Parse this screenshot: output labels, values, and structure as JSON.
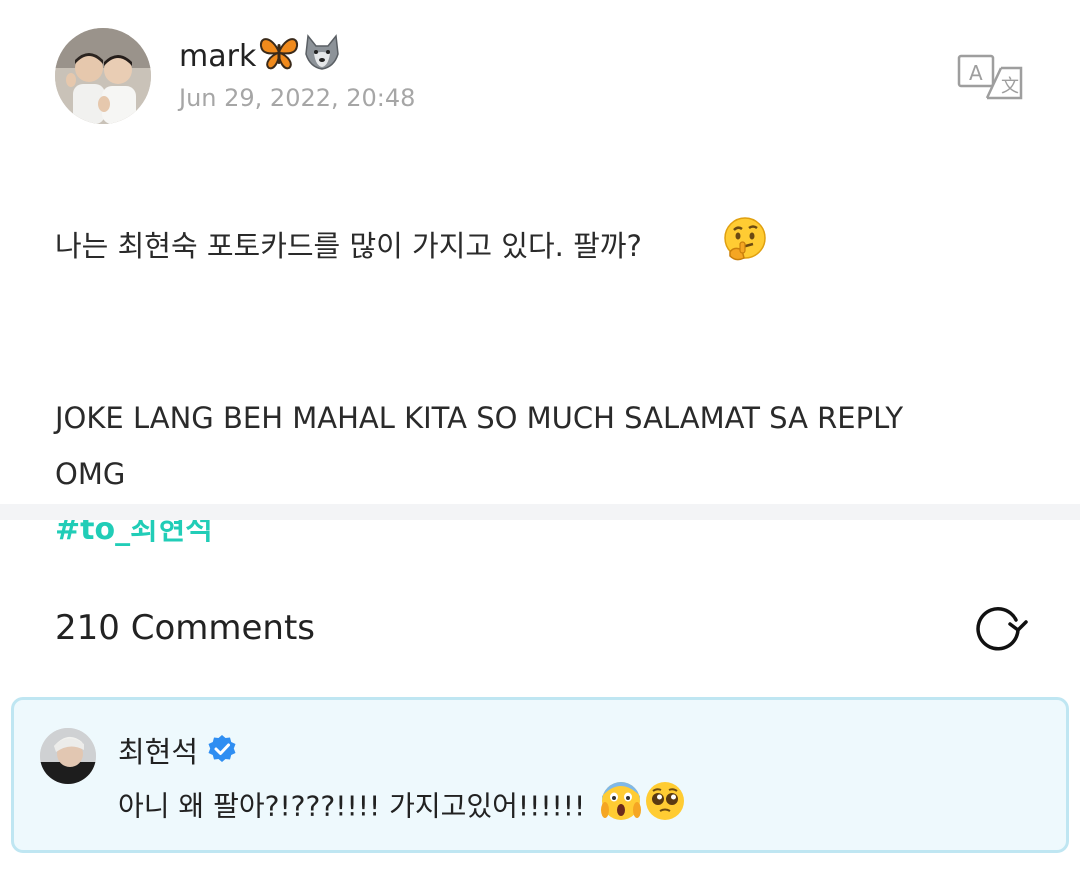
{
  "post": {
    "author_name": "mark",
    "author_emoji": [
      "butterfly-emoji",
      "wolf-emoji"
    ],
    "date": "Jun 29, 2022, 20:48",
    "line1": "나는 최현숙 포토카드를 많이 가지고 있다. 팔까?",
    "line1_emoji": "thinking-face-emoji",
    "line2": "JOKE LANG BEH MAHAL KITA SO MUCH SALAMAT SA REPLY\nOMG",
    "hashtag": "#to_최현석",
    "translate_icon": "translate-icon"
  },
  "comments": {
    "count_label": "210 Comments",
    "refresh_icon": "refresh-icon",
    "items": [
      {
        "author": "최현석",
        "verified": true,
        "text": "아니 왜 팔아?!???!!!! 가지고있어!!!!!!",
        "emoji": [
          "scream-emoji",
          "pleading-face-emoji"
        ]
      }
    ]
  },
  "colors": {
    "hashtag": "#21cdb7",
    "date": "#a6a6a6",
    "comment_bg": "#eef9fd",
    "comment_border": "#bfe6f2",
    "verified": "#2f8ef2",
    "divider": "#f3f4f6"
  }
}
